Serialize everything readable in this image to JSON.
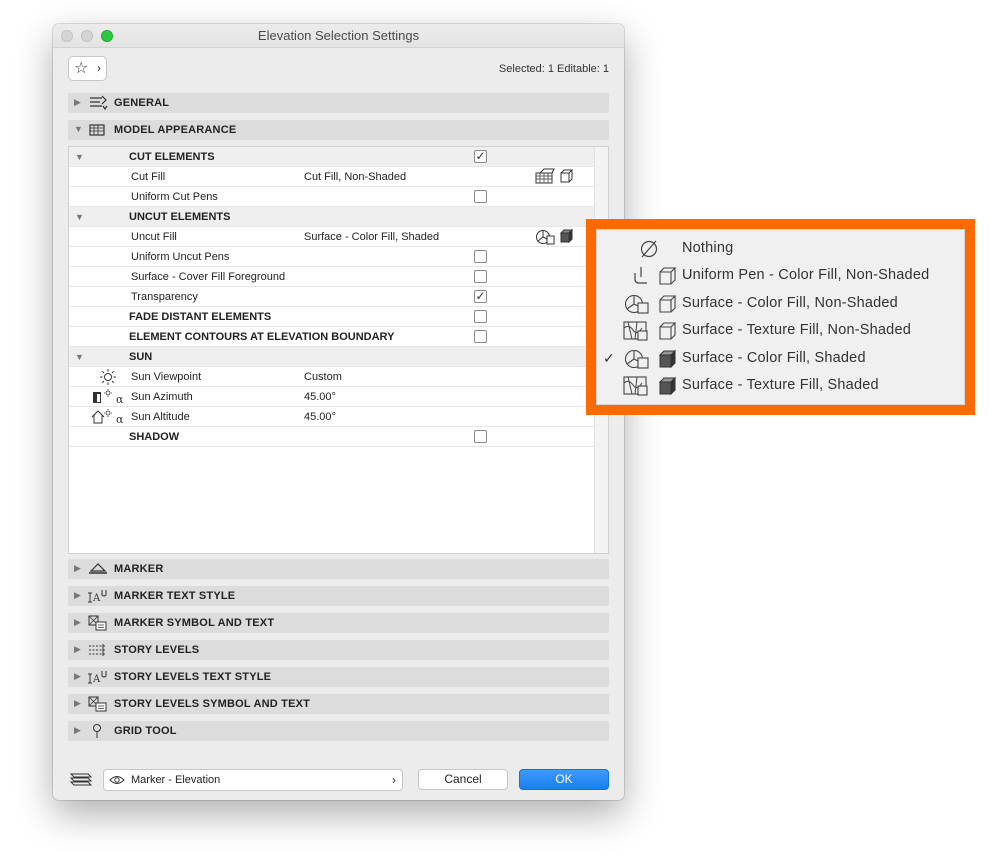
{
  "window": {
    "title": "Elevation Selection Settings",
    "selected_info": "Selected: 1 Editable: 1"
  },
  "sections_top": [
    {
      "label": "GENERAL",
      "expanded": false,
      "icon": "general-settings-icon"
    },
    {
      "label": "MODEL APPEARANCE",
      "expanded": true,
      "icon": "model-appearance-icon"
    }
  ],
  "model_appearance": {
    "cut_elements": {
      "label": "CUT ELEMENTS",
      "checked": true,
      "cut_fill": {
        "label": "Cut Fill",
        "value": "Cut Fill, Non-Shaded"
      },
      "uniform_cut_pens": {
        "label": "Uniform Cut Pens",
        "checked": false
      }
    },
    "uncut_elements": {
      "label": "UNCUT ELEMENTS",
      "uncut_fill": {
        "label": "Uncut Fill",
        "value": "Surface - Color Fill, Shaded"
      },
      "uniform_uncut_pens": {
        "label": "Uniform Uncut Pens",
        "checked": false
      },
      "surface_cover_fill": {
        "label": "Surface - Cover Fill Foreground",
        "checked": false
      },
      "transparency": {
        "label": "Transparency",
        "checked": true
      }
    },
    "fade_distant": {
      "label": "FADE DISTANT ELEMENTS",
      "checked": false
    },
    "element_contours": {
      "label": "ELEMENT CONTOURS AT ELEVATION BOUNDARY",
      "checked": false
    },
    "sun": {
      "label": "SUN",
      "viewpoint": {
        "label": "Sun Viewpoint",
        "value": "Custom"
      },
      "azimuth": {
        "label": "Sun Azimuth",
        "value": "45.00°"
      },
      "altitude": {
        "label": "Sun Altitude",
        "value": "45.00°"
      }
    },
    "shadow": {
      "label": "SHADOW",
      "checked": false
    }
  },
  "sections_bottom": [
    {
      "label": "MARKER",
      "icon": "marker-icon"
    },
    {
      "label": "MARKER TEXT STYLE",
      "icon": "text-style-icon"
    },
    {
      "label": "MARKER SYMBOL AND TEXT",
      "icon": "symbol-text-icon"
    },
    {
      "label": "STORY LEVELS",
      "icon": "story-levels-icon"
    },
    {
      "label": "STORY LEVELS TEXT STYLE",
      "icon": "text-style-icon"
    },
    {
      "label": "STORY LEVELS SYMBOL AND TEXT",
      "icon": "symbol-text-icon"
    },
    {
      "label": "GRID TOOL",
      "icon": "grid-tool-icon"
    }
  ],
  "footer": {
    "view_label": "Marker - Elevation",
    "cancel_label": "Cancel",
    "ok_label": "OK"
  },
  "popup_menu": {
    "items": [
      {
        "label": "Nothing",
        "checked": false
      },
      {
        "label": "Uniform Pen - Color Fill, Non-Shaded",
        "checked": false
      },
      {
        "label": "Surface - Color Fill, Non-Shaded",
        "checked": false
      },
      {
        "label": "Surface - Texture Fill, Non-Shaded",
        "checked": false
      },
      {
        "label": "Surface - Color Fill, Shaded",
        "checked": true
      },
      {
        "label": "Surface - Texture Fill, Shaded",
        "checked": false
      }
    ],
    "check_glyph": "✓",
    "highlight_color": "#ff6a00"
  },
  "colors": {
    "accent": "#1a7ef1",
    "traffic_green": "#2dc93f"
  }
}
